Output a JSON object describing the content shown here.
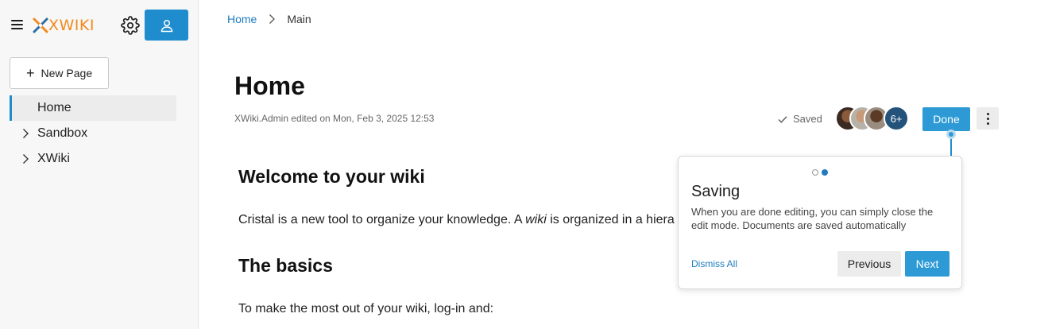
{
  "sidebar": {
    "brand": "XWIKI",
    "new_page_label": "New Page",
    "items": [
      {
        "label": "Home",
        "active": true
      },
      {
        "label": "Sandbox",
        "active": false
      },
      {
        "label": "XWiki",
        "active": false
      }
    ]
  },
  "breadcrumb": {
    "home": "Home",
    "current": "Main"
  },
  "page": {
    "title": "Home",
    "edit_info": "XWiki.Admin edited on Mon, Feb 3, 2025 12:53",
    "save_status": "Saved",
    "collaborators_more": "6+",
    "done_label": "Done"
  },
  "content": {
    "heading_welcome": "Welcome to your wiki",
    "intro_before": "Cristal is a new tool to organize your knowledge. A ",
    "intro_em": "wiki",
    "intro_after": " is organized in a hiera",
    "heading_basics": "The basics",
    "login_text": "To make the most out of your wiki, log-in and:"
  },
  "tour": {
    "title": "Saving",
    "body": "When you are done editing, you can simply close the edit mode. Documents are saved automatically",
    "dismiss_label": "Dismiss All",
    "previous_label": "Previous",
    "next_label": "Next",
    "current_step": 2,
    "total_steps": 2
  },
  "colors": {
    "accent": "#2d9ad6",
    "brand_orange": "#f28a1e",
    "link": "#1f7cc0"
  }
}
